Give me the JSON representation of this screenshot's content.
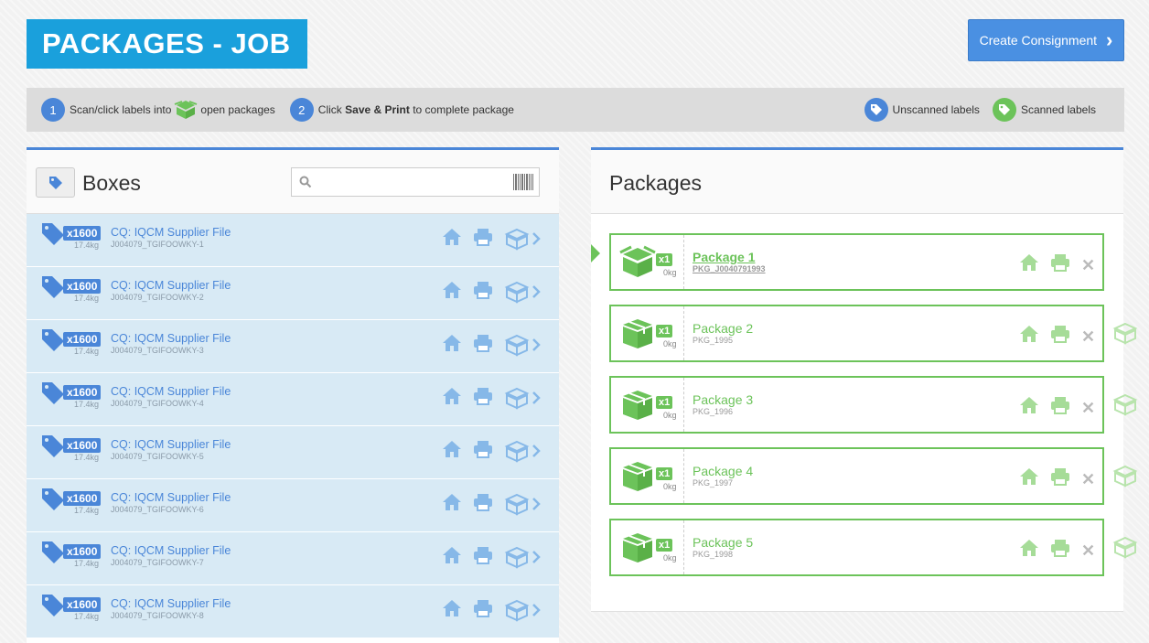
{
  "header": {
    "title": "PACKAGES - JOB",
    "create_button": "Create Consignment"
  },
  "help": {
    "step1_num": "1",
    "step1_pre": "Scan/click labels into",
    "step1_post": "open packages",
    "step2_num": "2",
    "step2_pre": "Click",
    "step2_bold": "Save & Print",
    "step2_post": "to complete package",
    "unscanned": "Unscanned labels",
    "scanned": "Scanned labels"
  },
  "boxes": {
    "title": "Boxes",
    "search_placeholder": "",
    "rows": [
      {
        "qty": "x1600",
        "weight": "17.4kg",
        "name": "CQ: IQCM Supplier File",
        "code": "J004079_TGIFOOWKY-1"
      },
      {
        "qty": "x1600",
        "weight": "17.4kg",
        "name": "CQ: IQCM Supplier File",
        "code": "J004079_TGIFOOWKY-2"
      },
      {
        "qty": "x1600",
        "weight": "17.4kg",
        "name": "CQ: IQCM Supplier File",
        "code": "J004079_TGIFOOWKY-3"
      },
      {
        "qty": "x1600",
        "weight": "17.4kg",
        "name": "CQ: IQCM Supplier File",
        "code": "J004079_TGIFOOWKY-4"
      },
      {
        "qty": "x1600",
        "weight": "17.4kg",
        "name": "CQ: IQCM Supplier File",
        "code": "J004079_TGIFOOWKY-5"
      },
      {
        "qty": "x1600",
        "weight": "17.4kg",
        "name": "CQ: IQCM Supplier File",
        "code": "J004079_TGIFOOWKY-6"
      },
      {
        "qty": "x1600",
        "weight": "17.4kg",
        "name": "CQ: IQCM Supplier File",
        "code": "J004079_TGIFOOWKY-7"
      },
      {
        "qty": "x1600",
        "weight": "17.4kg",
        "name": "CQ: IQCM Supplier File",
        "code": "J004079_TGIFOOWKY-8"
      }
    ]
  },
  "packages": {
    "title": "Packages",
    "items": [
      {
        "qty": "x1",
        "weight": "0kg",
        "name": "Package 1",
        "code": "PKG_J0040791993",
        "active": true
      },
      {
        "qty": "x1",
        "weight": "0kg",
        "name": "Package 2",
        "code": "PKG_1995",
        "active": false
      },
      {
        "qty": "x1",
        "weight": "0kg",
        "name": "Package 3",
        "code": "PKG_1996",
        "active": false
      },
      {
        "qty": "x1",
        "weight": "0kg",
        "name": "Package 4",
        "code": "PKG_1997",
        "active": false
      },
      {
        "qty": "x1",
        "weight": "0kg",
        "name": "Package 5",
        "code": "PKG_1998",
        "active": false
      }
    ]
  },
  "colors": {
    "accent_blue": "#4a86d8",
    "title_blue": "#1aa0dc",
    "green": "#6cc35a",
    "row_blue": "#d8eaf5"
  },
  "icons": {
    "tag": "tag-icon",
    "open_package": "open-box-icon",
    "closed_package": "closed-box-icon",
    "home": "home-icon",
    "print": "printer-icon",
    "remove": "close-icon",
    "search": "search-icon",
    "barcode": "barcode-icon"
  }
}
